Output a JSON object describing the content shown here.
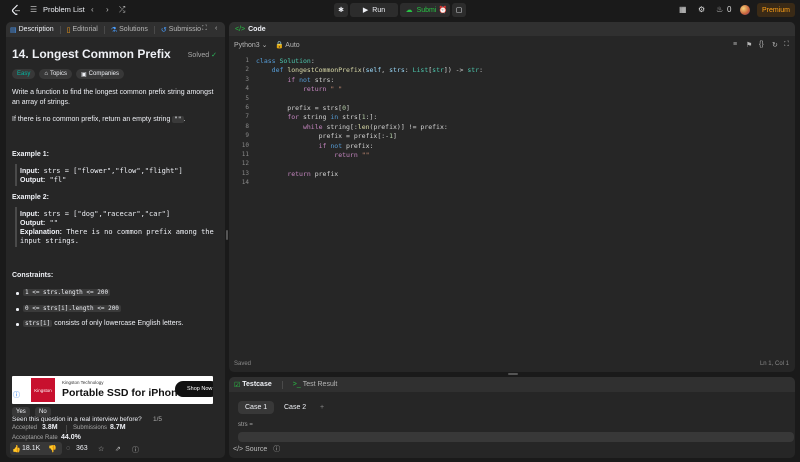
{
  "nav": {
    "title": "Problem List",
    "run_label": "Run",
    "submit_label": "Submit",
    "notifications": "0",
    "premium_label": "Premium",
    "accent": "#ffa116"
  },
  "left_tabs": [
    "Description",
    "Editorial",
    "Solutions",
    "Submissio"
  ],
  "problem": {
    "title": "14. Longest Common Prefix",
    "status": "Solved",
    "difficulty": "Easy",
    "topics_label": "Topics",
    "companies_label": "Companies",
    "desc_line1": "Write a function to find the longest common prefix string amongst",
    "desc_line2": "an array of strings.",
    "desc_line3a": "If there is no common prefix, return an empty string ",
    "desc_line3_code": "\"\"",
    "desc_line3b": ".",
    "example1_title": "Example 1:",
    "example1_input_label": "Input:",
    "example1_input": " strs = [\"flower\",\"flow\",\"flight\"]",
    "example1_output_label": "Output:",
    "example1_output": " \"fl\"",
    "example2_title": "Example 2:",
    "example2_input_label": "Input:",
    "example2_input": " strs = [\"dog\",\"racecar\",\"car\"]",
    "example2_output_label": "Output:",
    "example2_output": " \"\"",
    "example2_expl_label": "Explanation:",
    "example2_expl1": " There is no common prefix among the",
    "example2_expl2": "input strings.",
    "constraints_title": "Constraints:",
    "c1": "1 <= strs.length <= 200",
    "c2": "0 <= strs[i].length <= 200",
    "c3_code": "strs[i]",
    "c3_text": " consists of only lowercase English letters."
  },
  "ad": {
    "small": "Kingston Technology",
    "big": "Portable SSD for iPhone 15",
    "button": "Shop Now",
    "logo_text": "Kingston"
  },
  "interview": {
    "question": "Seen this question in a real interview before?",
    "count": "1/5",
    "yes": "Yes",
    "no": "No"
  },
  "stats": {
    "accepted_label": "Accepted",
    "accepted_value": "3.8M",
    "submissions_label": "Submissions",
    "submissions_value": "8.7M",
    "rate_label": "Acceptance Rate",
    "rate_value": "44.0%"
  },
  "footer": {
    "likes": "18.1K",
    "comments": "363"
  },
  "code": {
    "header": "Code",
    "language": "Python3",
    "mode": "Auto",
    "saved": "Saved",
    "position": "Ln 1, Col 1",
    "line_numbers": [
      "1",
      "2",
      "3",
      "4",
      "5",
      "6",
      "7",
      "8",
      "9",
      "10",
      "11",
      "12",
      "13",
      "14"
    ]
  },
  "test": {
    "tab1": "Testcase",
    "tab2": "Test Result",
    "case1": "Case 1",
    "case2": "Case 2",
    "add": "+",
    "var_label": "strs =",
    "source": "Source"
  }
}
